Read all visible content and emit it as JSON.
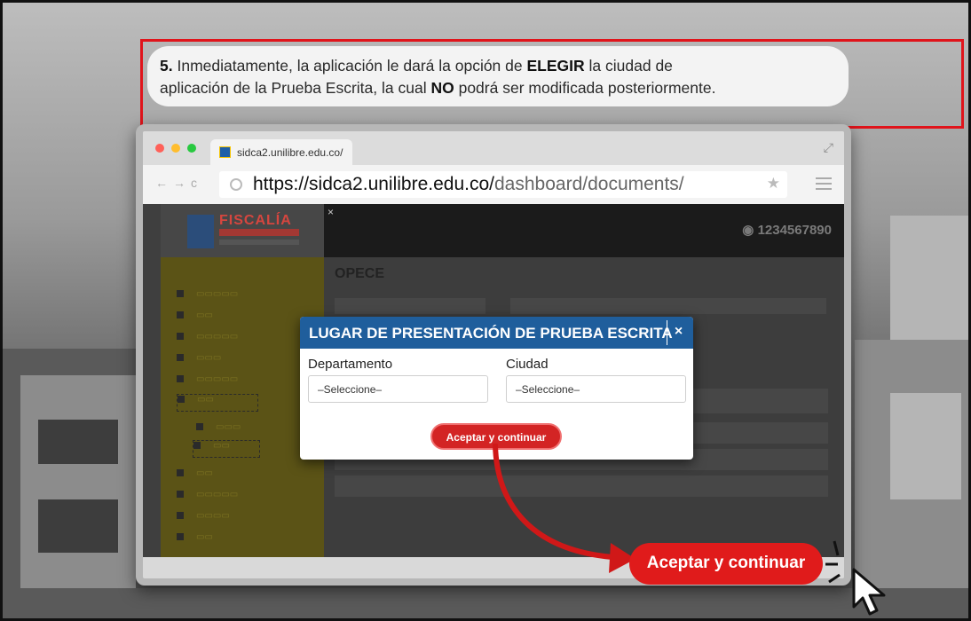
{
  "banner": {
    "step": "5.",
    "line1_a": "Inmediatamente, la aplicación le dará la opción de",
    "line1_b": "ELEGIR",
    "line1_c": "la ciudad de",
    "line2_a": "aplicación de la Prueba Escrita, la cual",
    "line2_b": "NO",
    "line2_c": "podrá ser modificada posteriormente."
  },
  "browser": {
    "tab_title": "sidca2.unilibre.edu.co/",
    "url_host": "https://sidca2.unilibre.edu.co/",
    "url_path": "dashboard/documents/"
  },
  "app": {
    "logo_text": "FISCALÍA",
    "user_id": "1234567890",
    "section_title": "OPECE"
  },
  "modal": {
    "title": "LUGAR DE PRESENTACIÓN DE PRUEBA ESCRITA",
    "close": "×",
    "departamento_label": "Departamento",
    "departamento_value": "–Seleccione–",
    "ciudad_label": "Ciudad",
    "ciudad_value": "–Seleccione–",
    "submit": "Aceptar y continuar"
  },
  "callout": {
    "button": "Aceptar y continuar"
  },
  "colors": {
    "accent_red": "#e01b1b",
    "modal_header": "#1f5e9c"
  }
}
